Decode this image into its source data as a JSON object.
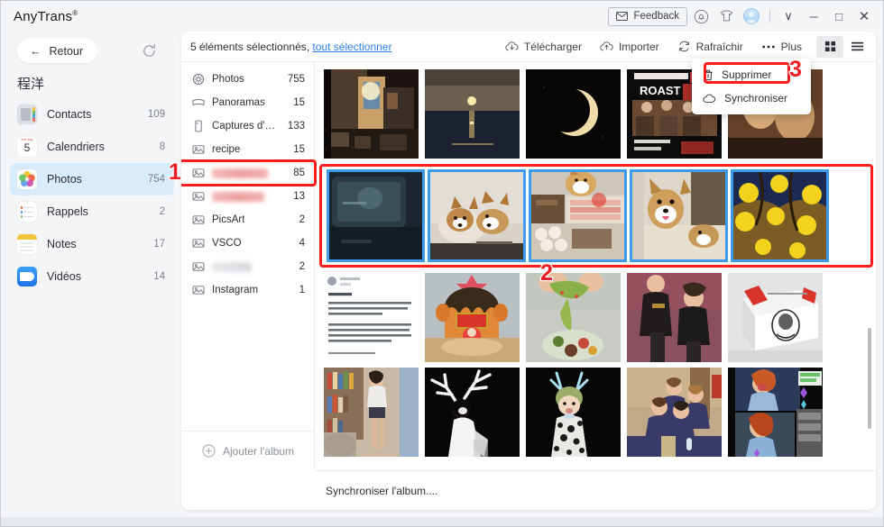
{
  "window": {
    "app_title": "AnyTrans",
    "app_title_sup": "®",
    "feedback_label": "Feedback",
    "bell_icon": "bell-icon",
    "shirt_icon": "shirt-icon",
    "avatar_icon": "avatar-icon",
    "chevron_label": "∨",
    "minimize_label": "─",
    "maximize_label": "□",
    "close_label": "✕"
  },
  "leftnav": {
    "back_label": "Retour",
    "refresh_icon": "refresh-icon",
    "user_name": "程洋",
    "items": [
      {
        "label": "Contacts",
        "count": "109",
        "icon": "contacts-icon",
        "active": false
      },
      {
        "label": "Calendriers",
        "count": "8",
        "icon": "calendar-icon",
        "active": false,
        "day": "5",
        "month": "the day"
      },
      {
        "label": "Photos",
        "count": "754",
        "icon": "photos-icon",
        "active": true
      },
      {
        "label": "Rappels",
        "count": "2",
        "icon": "reminders-icon",
        "active": false
      },
      {
        "label": "Notes",
        "count": "17",
        "icon": "notes-icon",
        "active": false
      },
      {
        "label": "Vidéos",
        "count": "14",
        "icon": "videos-icon",
        "active": false
      }
    ]
  },
  "header": {
    "selection_count_text": "5 éléments sélectionnés,",
    "select_all_link": "tout sélectionner",
    "actions": [
      {
        "label": "Télécharger",
        "icon": "download-cloud-icon"
      },
      {
        "label": "Importer",
        "icon": "upload-cloud-icon"
      },
      {
        "label": "Rafraîchir",
        "icon": "refresh-icon"
      },
      {
        "label": "Plus",
        "icon": "more-dots-icon"
      }
    ],
    "view_grid_icon": "grid-view-icon",
    "view_list_icon": "list-view-icon",
    "view_active": "grid"
  },
  "dropdown": {
    "visible": true,
    "items": [
      {
        "label": "Supprimer",
        "icon": "trash-icon",
        "highlighted": true
      },
      {
        "label": "Synchroniser",
        "icon": "cloud-icon",
        "highlighted": false
      }
    ]
  },
  "albums": {
    "items": [
      {
        "label": "Photos",
        "count": "755",
        "blurred": false,
        "icon": "photos-album-icon",
        "selected": false
      },
      {
        "label": "Panoramas",
        "count": "15",
        "blurred": false,
        "icon": "panorama-icon",
        "selected": false
      },
      {
        "label": "Captures d'…",
        "count": "133",
        "blurred": false,
        "icon": "screenshot-icon",
        "selected": false
      },
      {
        "label": "recipe",
        "count": "15",
        "blurred": false,
        "icon": "album-icon",
        "selected": false
      },
      {
        "label": "",
        "count": "85",
        "blurred": true,
        "icon": "album-icon",
        "selected": true,
        "blur_width": 62
      },
      {
        "label": "",
        "count": "13",
        "blurred": true,
        "icon": "album-icon",
        "selected": false,
        "blur_width": 58
      },
      {
        "label": "PicsArt",
        "count": "2",
        "blurred": false,
        "icon": "album-icon",
        "selected": false
      },
      {
        "label": "VSCO",
        "count": "4",
        "blurred": false,
        "icon": "album-icon",
        "selected": false
      },
      {
        "label": "",
        "count": "2",
        "blurred": true,
        "icon": "album-icon",
        "selected": false,
        "blur_width": 44
      },
      {
        "label": "Instagram",
        "count": "1",
        "blurred": false,
        "icon": "album-icon",
        "selected": false
      }
    ],
    "add_album_label": "Ajouter l'album",
    "add_album_icon": "plus-circle-icon"
  },
  "grid": {
    "rows": [
      {
        "selected_row": false,
        "cells": [
          {
            "name": "photo-street-night",
            "selected": false
          },
          {
            "name": "photo-sunset-sea",
            "selected": false
          },
          {
            "name": "photo-crescent-moon",
            "selected": false
          },
          {
            "name": "photo-roast-poster",
            "selected": false
          },
          {
            "name": "photo-portrait-warm",
            "selected": false
          }
        ]
      },
      {
        "selected_row": true,
        "cells": [
          {
            "name": "photo-car-window",
            "selected": true
          },
          {
            "name": "photo-two-corgis",
            "selected": true
          },
          {
            "name": "photo-dog-groceries",
            "selected": true
          },
          {
            "name": "photo-corgi-sofa",
            "selected": true
          },
          {
            "name": "photo-lanterns",
            "selected": true
          }
        ]
      },
      {
        "selected_row": false,
        "cells": [
          {
            "name": "photo-text-screenshot",
            "selected": false
          },
          {
            "name": "photo-christmas-cake",
            "selected": false
          },
          {
            "name": "photo-avocado-sauce",
            "selected": false
          },
          {
            "name": "photo-two-people",
            "selected": false
          },
          {
            "name": "photo-kfc-box",
            "selected": false
          }
        ]
      },
      {
        "selected_row": false,
        "cells": [
          {
            "name": "photo-woman-bookshelf",
            "selected": false
          },
          {
            "name": "photo-antlers-white",
            "selected": false
          },
          {
            "name": "photo-antlers-green",
            "selected": false
          },
          {
            "name": "photo-group-school",
            "selected": false
          },
          {
            "name": "photo-stream-collage",
            "selected": false
          }
        ]
      }
    ]
  },
  "status": {
    "text": "Synchroniser l'album...."
  },
  "markers": [
    {
      "label": "1",
      "name": "step-marker-1"
    },
    {
      "label": "2",
      "name": "step-marker-2"
    },
    {
      "label": "3",
      "name": "step-marker-3"
    }
  ],
  "colors": {
    "accent_blue": "#2f80ed",
    "selection_blue": "#3d9bed",
    "marker_red": "#ee1c25",
    "highlight_red": "#fd1d1d",
    "active_nav": "#d9ecfb"
  }
}
